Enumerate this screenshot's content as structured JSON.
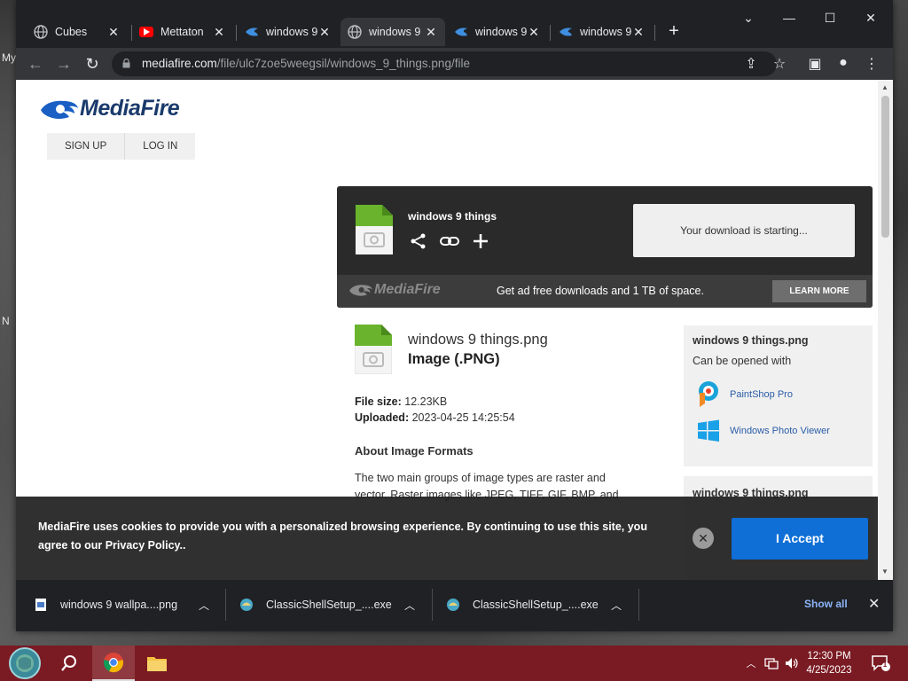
{
  "desktop": {
    "labels": [
      "My",
      "N"
    ]
  },
  "browser": {
    "tabs": [
      {
        "title": "Cubes",
        "favicon": "globe-icon",
        "active": false
      },
      {
        "title": "Mettaton",
        "favicon": "youtube-icon",
        "active": false
      },
      {
        "title": "windows 9",
        "favicon": "mediafire-icon",
        "active": false
      },
      {
        "title": "windows 9",
        "favicon": "globe-icon",
        "active": true
      },
      {
        "title": "windows 9",
        "favicon": "mediafire-icon",
        "active": false
      },
      {
        "title": "windows 9",
        "favicon": "mediafire-icon",
        "active": false
      }
    ],
    "url_host": "mediafire.com",
    "url_path": "/file/ulc7zoe5weegsil/windows_9_things.png/file"
  },
  "page": {
    "brand": "MediaFire",
    "signup": "SIGN UP",
    "login": "LOG IN",
    "download_box": {
      "filename": "windows 9 things",
      "status": "Your download is starting...",
      "promo": "Get ad free downloads and 1 TB of space.",
      "learn_more": "LEARN MORE",
      "brand": "MediaFire"
    },
    "file": {
      "name": "windows 9 things.png",
      "type": "Image (.PNG)",
      "size_label": "File size:",
      "size": "12.23KB",
      "uploaded_label": "Uploaded:",
      "uploaded": "2023-04-25 14:25:54"
    },
    "about_heading": "About Image Formats",
    "about_text": "The two main groups of image types are raster and vector. Raster images like JPEG, TIFF, GIF, BMP, and",
    "sidebar": {
      "title": "windows 9 things.png",
      "subtitle": "Can be opened with",
      "apps": [
        {
          "name": "PaintShop Pro"
        },
        {
          "name": "Windows Photo Viewer"
        }
      ],
      "title2": "windows 9 things.png"
    },
    "cookie": {
      "text": "MediaFire uses cookies to provide you with a personalized browsing experience. By continuing to use this site, you agree to our Privacy Policy..",
      "accept": "I Accept"
    }
  },
  "downloads": {
    "items": [
      {
        "name": "windows 9 wallpa....png"
      },
      {
        "name": "ClassicShellSetup_....exe"
      },
      {
        "name": "ClassicShellSetup_....exe"
      }
    ],
    "show_all": "Show all"
  },
  "taskbar": {
    "time": "12:30 PM",
    "date": "4/25/2023",
    "notification_count": "1"
  },
  "colors": {
    "mediafire_blue": "#1a3a6b",
    "accept_blue": "#0f6fd6",
    "taskbar": "#7a1a22"
  }
}
